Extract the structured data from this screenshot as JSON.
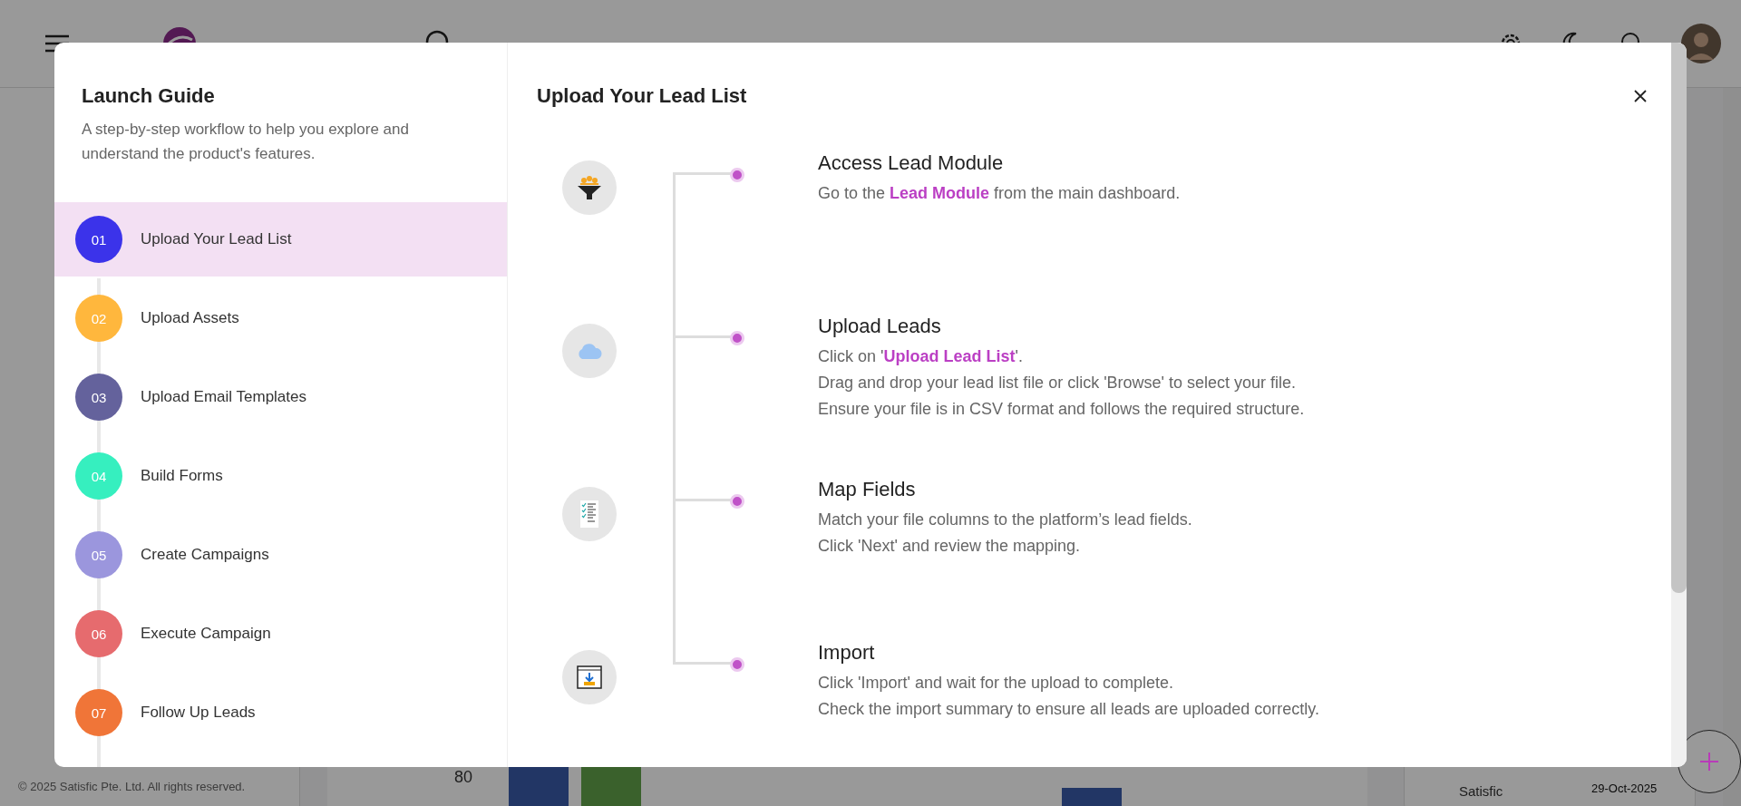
{
  "background": {
    "footer": "© 2025 Satisfic Pte. Ltd. All rights reserved.",
    "chart_tick": "80",
    "card_name": "Satisfic",
    "card_date": "29-Oct-2025"
  },
  "guide": {
    "title": "Launch Guide",
    "subtitle": "A step-by-step workflow to help you explore and understand the product's features.",
    "items": [
      {
        "number": "01",
        "label": "Upload Your Lead List",
        "color": "#3b33ea",
        "selected": true
      },
      {
        "number": "02",
        "label": "Upload Assets",
        "color": "#ffb73d",
        "selected": false
      },
      {
        "number": "03",
        "label": "Upload Email Templates",
        "color": "#64629c",
        "selected": false
      },
      {
        "number": "04",
        "label": "Build Forms",
        "color": "#36efbf",
        "selected": false
      },
      {
        "number": "05",
        "label": "Create Campaigns",
        "color": "#9b96dd",
        "selected": false
      },
      {
        "number": "06",
        "label": "Execute Campaign",
        "color": "#e66b6e",
        "selected": false
      },
      {
        "number": "07",
        "label": "Follow Up Leads",
        "color": "#f07538",
        "selected": false
      }
    ]
  },
  "detail": {
    "title": "Upload Your Lead List",
    "steps": [
      {
        "kind": "funnel",
        "title": "Access Lead Module",
        "lines": [
          "Go to the **Lead Module** from the main dashboard."
        ]
      },
      {
        "kind": "cloud",
        "title": "Upload Leads",
        "lines": [
          "Click on '**Upload Lead List**'.",
          "Drag and drop your lead list file or click 'Browse' to select your file.",
          "Ensure your file is in CSV format and follows the required structure."
        ]
      },
      {
        "kind": "checklist",
        "title": "Map Fields",
        "lines": [
          "Match your file columns to the platform’s lead fields.",
          "Click 'Next' and review the mapping."
        ]
      },
      {
        "kind": "import",
        "title": "Import",
        "lines": [
          "Click 'Import' and wait for the upload to complete.",
          "Check the import summary to ensure all leads are uploaded correctly."
        ]
      }
    ]
  }
}
